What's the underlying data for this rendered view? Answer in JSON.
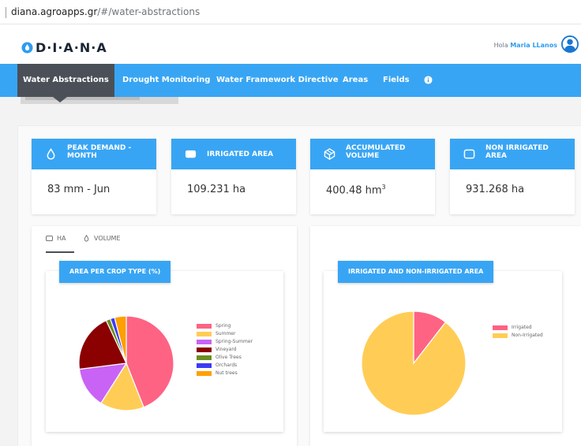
{
  "browser": {
    "url_domain": "diana.agroapps.gr",
    "url_path": "/#/water-abstractions"
  },
  "header": {
    "logo_text": "D·I·A·N·A",
    "greeting": "Hola",
    "user_name": "Maria LLanos"
  },
  "nav": {
    "items": [
      {
        "label": "Water Abstractions",
        "active": true
      },
      {
        "label": "Drought Monitoring",
        "active": false
      },
      {
        "label": "Water Framework Directive",
        "active": false
      },
      {
        "label": "Areas",
        "active": false
      },
      {
        "label": "Fields",
        "active": false
      }
    ]
  },
  "stats": [
    {
      "label": "PEAK DEMAND - MONTH",
      "value": "83 mm - Jun",
      "icon": "drop-icon"
    },
    {
      "label": "IRRIGATED AREA",
      "value": "109.231 ha",
      "icon": "area-icon"
    },
    {
      "label": "ACCUMULATED VOLUME",
      "value": "400.48 hm",
      "value_sup": "3",
      "icon": "volume-icon"
    },
    {
      "label": "NON IRRIGATED AREA",
      "value": "931.268 ha",
      "icon": "square-icon"
    }
  ],
  "tabs": [
    {
      "label": "HA",
      "icon": "area-icon",
      "active": true
    },
    {
      "label": "VOLUME",
      "icon": "drop-icon",
      "active": false
    }
  ],
  "chart_data": [
    {
      "type": "pie",
      "title": "AREA PER CROP TYPE (%)",
      "categories": [
        "Spring",
        "Summer",
        "Spring-Summer",
        "Vineyard",
        "Olive Trees",
        "Orchards",
        "Nut trees"
      ],
      "values": [
        44,
        15,
        14,
        20,
        1.5,
        1.5,
        4
      ],
      "colors": [
        "#fe6384",
        "#ffcd56",
        "#c963f6",
        "#8b0000",
        "#6b8e23",
        "#3b3bf7",
        "#ff9f00"
      ]
    },
    {
      "type": "pie",
      "title": "IRRIGATED AND NON-IRRIGATED AREA",
      "categories": [
        "Irrigated",
        "Non-Irrigated"
      ],
      "values": [
        10.5,
        89.5
      ],
      "colors": [
        "#fe6384",
        "#ffcd56"
      ]
    }
  ]
}
